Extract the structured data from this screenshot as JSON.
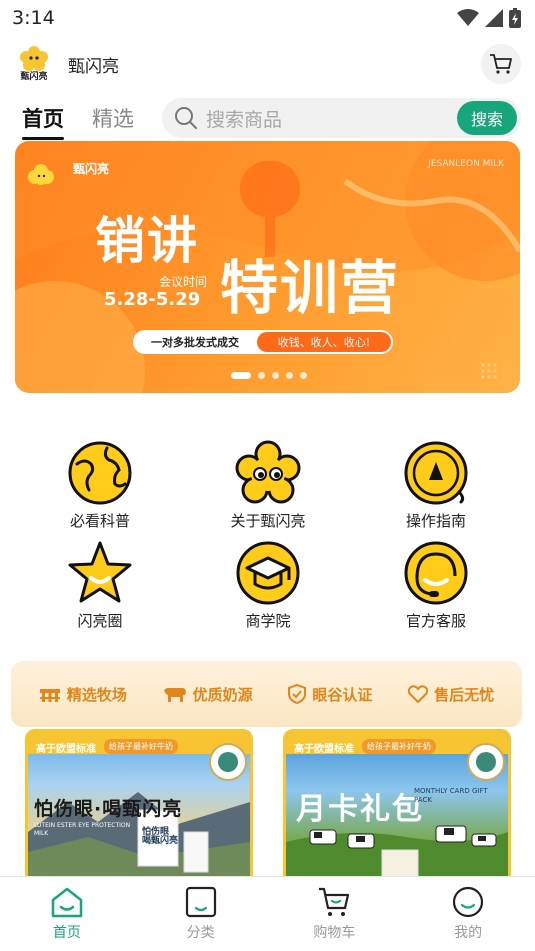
{
  "status_bar": {
    "time": "3:14"
  },
  "header": {
    "brand_name": "甄闪亮",
    "logo_text": "甄闪亮"
  },
  "tabs": [
    {
      "label": "首页",
      "active": true
    },
    {
      "label": "精选",
      "active": false
    }
  ],
  "search": {
    "placeholder": "搜索商品",
    "button_label": "搜索"
  },
  "banner": {
    "brand": "甄闪亮",
    "english": "JESANLEON MILK",
    "title_line1": "销讲",
    "title_line2": "特训营",
    "meeting_label": "会议时间",
    "date": "5.28-5.29",
    "pill_left": "一对多批发式成交",
    "pill_right": "收钱、收人、收心!",
    "slide_count": 5,
    "active_slide": 1
  },
  "quick_links": [
    {
      "label": "必看科普",
      "icon": "globe-icon"
    },
    {
      "label": "关于甄闪亮",
      "icon": "flower-mascot-icon"
    },
    {
      "label": "操作指南",
      "icon": "compass-icon"
    },
    {
      "label": "闪亮圈",
      "icon": "star-icon"
    },
    {
      "label": "商学院",
      "icon": "graduation-cap-icon"
    },
    {
      "label": "官方客服",
      "icon": "headset-icon"
    }
  ],
  "features": [
    {
      "label": "精选牧场",
      "icon": "ranch-icon"
    },
    {
      "label": "优质奶源",
      "icon": "cow-icon"
    },
    {
      "label": "眼谷认证",
      "icon": "shield-check-icon"
    },
    {
      "label": "售后无忧",
      "icon": "heart-icon"
    }
  ],
  "products": [
    {
      "tag": "高于欧盟标准",
      "tag2": "给孩子最补好牛奶",
      "title": "怕伤眼·喝甄闪亮",
      "subtitle": "LUTEIN ESTER EYE PROTECTION MILK",
      "box_text": "怕伤眼 喝甄闪亮"
    },
    {
      "tag": "高于欧盟标准",
      "tag2": "给孩子最补好牛奶",
      "title": "月卡礼包",
      "subtitle": "MONTHLY CARD GIFT PACK"
    }
  ],
  "bottom_nav": [
    {
      "label": "首页",
      "icon": "home-icon",
      "active": true
    },
    {
      "label": "分类",
      "icon": "category-icon",
      "active": false
    },
    {
      "label": "购物车",
      "icon": "cart-icon",
      "active": false
    },
    {
      "label": "我的",
      "icon": "profile-icon",
      "active": false
    }
  ],
  "colors": {
    "accent": "#17a67c",
    "banner_orange": "#ff8a22",
    "icon_yellow": "#ffcc1a",
    "feature_orange": "#e0861a"
  }
}
